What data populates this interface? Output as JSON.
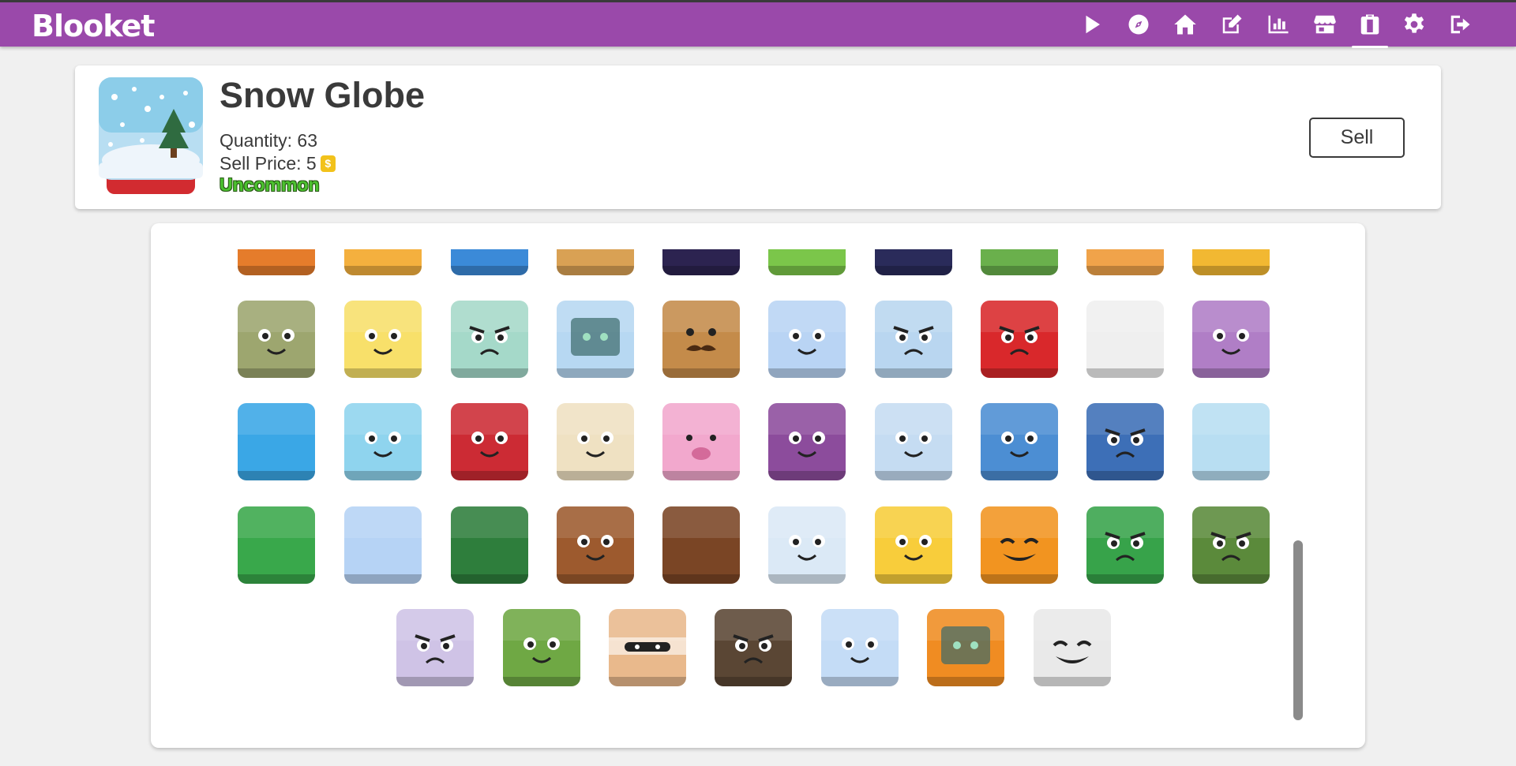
{
  "app": {
    "logo": "Blooket"
  },
  "nav": [
    {
      "icon": "play-icon",
      "label": "Play"
    },
    {
      "icon": "compass-icon",
      "label": "Discover"
    },
    {
      "icon": "home-icon",
      "label": "Home"
    },
    {
      "icon": "edit-icon",
      "label": "Create"
    },
    {
      "icon": "stats-icon",
      "label": "Stats"
    },
    {
      "icon": "market-icon",
      "label": "Market"
    },
    {
      "icon": "blooks-icon",
      "label": "Blooks",
      "active": true
    },
    {
      "icon": "gear-icon",
      "label": "Settings"
    },
    {
      "icon": "logout-icon",
      "label": "Logout"
    }
  ],
  "selected": {
    "name": "Snow Globe",
    "quantity": "Quantity: 63",
    "sell_price": "Sell Price: 5",
    "rarity": "Uncommon",
    "rarity_color": "#4bc22e",
    "sell_label": "Sell"
  },
  "blooks": [
    {
      "name": "fruit-tart",
      "bg": "#e57c2b",
      "face": "none"
    },
    {
      "name": "pizza",
      "bg": "#f4b03e",
      "face": "none"
    },
    {
      "name": "earth",
      "bg": "#3b8ad8",
      "face": "none"
    },
    {
      "name": "cardboard-box",
      "bg": "#d9a154",
      "face": "none"
    },
    {
      "name": "galaxy",
      "bg": "#2c2350",
      "face": "none"
    },
    {
      "name": "alien",
      "bg": "#7bc64a",
      "face": "alien"
    },
    {
      "name": "toast-spaceship",
      "bg": "#2a2b5a",
      "face": "none"
    },
    {
      "name": "ufo",
      "bg": "#6ab04c",
      "face": "none"
    },
    {
      "name": "rocket",
      "bg": "#f0a34a",
      "face": "none"
    },
    {
      "name": "tablet-robot",
      "bg": "#f2b832",
      "face": "none"
    },
    {
      "name": "boiler",
      "bg": "#9da66f",
      "face": "happy"
    },
    {
      "name": "lovely-bot",
      "bg": "#f8e06a",
      "face": "happy"
    },
    {
      "name": "mini-bot",
      "bg": "#a5d9c9",
      "face": "angry"
    },
    {
      "name": "computer-bot",
      "bg": "#b7d8f2",
      "face": "screen"
    },
    {
      "name": "wooden-bot",
      "bg": "#c48b4a",
      "face": "mustache"
    },
    {
      "name": "vampire-bot",
      "bg": "#b9d4f4",
      "face": "happy"
    },
    {
      "name": "brainy-bot",
      "bg": "#b9d6f0",
      "face": "angry"
    },
    {
      "name": "mega-bot",
      "bg": "#d9282b",
      "face": "angry"
    },
    {
      "name": "boot",
      "bg": "#efefef",
      "face": "none"
    },
    {
      "name": "jellyfish",
      "bg": "#b07ec6",
      "face": "happy"
    },
    {
      "name": "clownfish",
      "bg": "#3aa7e6",
      "face": "none"
    },
    {
      "name": "frog",
      "bg": "#8fd4ee",
      "face": "happy"
    },
    {
      "name": "crab",
      "bg": "#cc2b34",
      "face": "happy"
    },
    {
      "name": "pufferfish",
      "bg": "#efe1c2",
      "face": "happy"
    },
    {
      "name": "blobfish",
      "bg": "#f2a8cd",
      "face": "sad"
    },
    {
      "name": "octopus",
      "bg": "#8c4c9c",
      "face": "happy"
    },
    {
      "name": "narwhal",
      "bg": "#c5dcf2",
      "face": "happy"
    },
    {
      "name": "dolphin",
      "bg": "#4c8ed3",
      "face": "happy"
    },
    {
      "name": "megalodon",
      "bg": "#3d6fb7",
      "face": "angry"
    },
    {
      "name": "snow-globe",
      "bg": "#b8def2",
      "face": "none"
    },
    {
      "name": "present",
      "bg": "#39a84b",
      "face": "none"
    },
    {
      "name": "hot-chocolate",
      "bg": "#b6d3f5",
      "face": "none"
    },
    {
      "name": "wreath",
      "bg": "#2e7e3c",
      "face": "none"
    },
    {
      "name": "gingerbread-man",
      "bg": "#9d5a2e",
      "face": "happy"
    },
    {
      "name": "gingerbread-house",
      "bg": "#7a4525",
      "face": "none"
    },
    {
      "name": "snowman",
      "bg": "#dbe9f6",
      "face": "happy"
    },
    {
      "name": "santa-claus",
      "bg": "#f8cd3b",
      "face": "happy"
    },
    {
      "name": "pumpkin",
      "bg": "#f29420",
      "face": "pumpkin"
    },
    {
      "name": "swamp-monster",
      "bg": "#37a34a",
      "face": "angry"
    },
    {
      "name": "frankenstein",
      "bg": "#5b8a3b",
      "face": "angry"
    },
    {
      "name": "vampire",
      "bg": "#cfc3e6",
      "face": "angry"
    },
    {
      "name": "zombie",
      "bg": "#6fa844",
      "face": "happy"
    },
    {
      "name": "mummy",
      "bg": "#e9b98c",
      "face": "mummy"
    },
    {
      "name": "werewolf",
      "bg": "#5a4634",
      "face": "angry"
    },
    {
      "name": "ghost",
      "bg": "#c4dcf6",
      "face": "happy"
    },
    {
      "name": "tim-the-alien",
      "bg": "#f08c22",
      "face": "screen"
    },
    {
      "name": "pumpkin-ghost",
      "bg": "#e9e9e9",
      "face": "pumpkin"
    }
  ]
}
